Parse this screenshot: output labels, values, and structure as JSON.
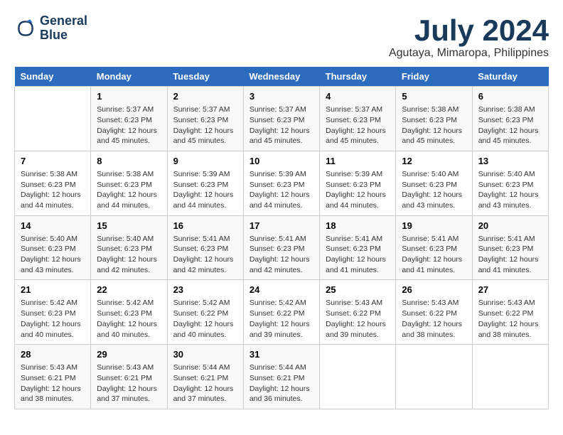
{
  "logo": {
    "line1": "General",
    "line2": "Blue"
  },
  "title": "July 2024",
  "subtitle": "Agutaya, Mimaropa, Philippines",
  "weekdays": [
    "Sunday",
    "Monday",
    "Tuesday",
    "Wednesday",
    "Thursday",
    "Friday",
    "Saturday"
  ],
  "weeks": [
    [
      {
        "day": "",
        "sunrise": "",
        "sunset": "",
        "daylight": ""
      },
      {
        "day": "1",
        "sunrise": "Sunrise: 5:37 AM",
        "sunset": "Sunset: 6:23 PM",
        "daylight": "Daylight: 12 hours and 45 minutes."
      },
      {
        "day": "2",
        "sunrise": "Sunrise: 5:37 AM",
        "sunset": "Sunset: 6:23 PM",
        "daylight": "Daylight: 12 hours and 45 minutes."
      },
      {
        "day": "3",
        "sunrise": "Sunrise: 5:37 AM",
        "sunset": "Sunset: 6:23 PM",
        "daylight": "Daylight: 12 hours and 45 minutes."
      },
      {
        "day": "4",
        "sunrise": "Sunrise: 5:37 AM",
        "sunset": "Sunset: 6:23 PM",
        "daylight": "Daylight: 12 hours and 45 minutes."
      },
      {
        "day": "5",
        "sunrise": "Sunrise: 5:38 AM",
        "sunset": "Sunset: 6:23 PM",
        "daylight": "Daylight: 12 hours and 45 minutes."
      },
      {
        "day": "6",
        "sunrise": "Sunrise: 5:38 AM",
        "sunset": "Sunset: 6:23 PM",
        "daylight": "Daylight: 12 hours and 45 minutes."
      }
    ],
    [
      {
        "day": "7",
        "sunrise": "Sunrise: 5:38 AM",
        "sunset": "Sunset: 6:23 PM",
        "daylight": "Daylight: 12 hours and 44 minutes."
      },
      {
        "day": "8",
        "sunrise": "Sunrise: 5:38 AM",
        "sunset": "Sunset: 6:23 PM",
        "daylight": "Daylight: 12 hours and 44 minutes."
      },
      {
        "day": "9",
        "sunrise": "Sunrise: 5:39 AM",
        "sunset": "Sunset: 6:23 PM",
        "daylight": "Daylight: 12 hours and 44 minutes."
      },
      {
        "day": "10",
        "sunrise": "Sunrise: 5:39 AM",
        "sunset": "Sunset: 6:23 PM",
        "daylight": "Daylight: 12 hours and 44 minutes."
      },
      {
        "day": "11",
        "sunrise": "Sunrise: 5:39 AM",
        "sunset": "Sunset: 6:23 PM",
        "daylight": "Daylight: 12 hours and 44 minutes."
      },
      {
        "day": "12",
        "sunrise": "Sunrise: 5:40 AM",
        "sunset": "Sunset: 6:23 PM",
        "daylight": "Daylight: 12 hours and 43 minutes."
      },
      {
        "day": "13",
        "sunrise": "Sunrise: 5:40 AM",
        "sunset": "Sunset: 6:23 PM",
        "daylight": "Daylight: 12 hours and 43 minutes."
      }
    ],
    [
      {
        "day": "14",
        "sunrise": "Sunrise: 5:40 AM",
        "sunset": "Sunset: 6:23 PM",
        "daylight": "Daylight: 12 hours and 43 minutes."
      },
      {
        "day": "15",
        "sunrise": "Sunrise: 5:40 AM",
        "sunset": "Sunset: 6:23 PM",
        "daylight": "Daylight: 12 hours and 42 minutes."
      },
      {
        "day": "16",
        "sunrise": "Sunrise: 5:41 AM",
        "sunset": "Sunset: 6:23 PM",
        "daylight": "Daylight: 12 hours and 42 minutes."
      },
      {
        "day": "17",
        "sunrise": "Sunrise: 5:41 AM",
        "sunset": "Sunset: 6:23 PM",
        "daylight": "Daylight: 12 hours and 42 minutes."
      },
      {
        "day": "18",
        "sunrise": "Sunrise: 5:41 AM",
        "sunset": "Sunset: 6:23 PM",
        "daylight": "Daylight: 12 hours and 41 minutes."
      },
      {
        "day": "19",
        "sunrise": "Sunrise: 5:41 AM",
        "sunset": "Sunset: 6:23 PM",
        "daylight": "Daylight: 12 hours and 41 minutes."
      },
      {
        "day": "20",
        "sunrise": "Sunrise: 5:41 AM",
        "sunset": "Sunset: 6:23 PM",
        "daylight": "Daylight: 12 hours and 41 minutes."
      }
    ],
    [
      {
        "day": "21",
        "sunrise": "Sunrise: 5:42 AM",
        "sunset": "Sunset: 6:23 PM",
        "daylight": "Daylight: 12 hours and 40 minutes."
      },
      {
        "day": "22",
        "sunrise": "Sunrise: 5:42 AM",
        "sunset": "Sunset: 6:23 PM",
        "daylight": "Daylight: 12 hours and 40 minutes."
      },
      {
        "day": "23",
        "sunrise": "Sunrise: 5:42 AM",
        "sunset": "Sunset: 6:22 PM",
        "daylight": "Daylight: 12 hours and 40 minutes."
      },
      {
        "day": "24",
        "sunrise": "Sunrise: 5:42 AM",
        "sunset": "Sunset: 6:22 PM",
        "daylight": "Daylight: 12 hours and 39 minutes."
      },
      {
        "day": "25",
        "sunrise": "Sunrise: 5:43 AM",
        "sunset": "Sunset: 6:22 PM",
        "daylight": "Daylight: 12 hours and 39 minutes."
      },
      {
        "day": "26",
        "sunrise": "Sunrise: 5:43 AM",
        "sunset": "Sunset: 6:22 PM",
        "daylight": "Daylight: 12 hours and 38 minutes."
      },
      {
        "day": "27",
        "sunrise": "Sunrise: 5:43 AM",
        "sunset": "Sunset: 6:22 PM",
        "daylight": "Daylight: 12 hours and 38 minutes."
      }
    ],
    [
      {
        "day": "28",
        "sunrise": "Sunrise: 5:43 AM",
        "sunset": "Sunset: 6:21 PM",
        "daylight": "Daylight: 12 hours and 38 minutes."
      },
      {
        "day": "29",
        "sunrise": "Sunrise: 5:43 AM",
        "sunset": "Sunset: 6:21 PM",
        "daylight": "Daylight: 12 hours and 37 minutes."
      },
      {
        "day": "30",
        "sunrise": "Sunrise: 5:44 AM",
        "sunset": "Sunset: 6:21 PM",
        "daylight": "Daylight: 12 hours and 37 minutes."
      },
      {
        "day": "31",
        "sunrise": "Sunrise: 5:44 AM",
        "sunset": "Sunset: 6:21 PM",
        "daylight": "Daylight: 12 hours and 36 minutes."
      },
      {
        "day": "",
        "sunrise": "",
        "sunset": "",
        "daylight": ""
      },
      {
        "day": "",
        "sunrise": "",
        "sunset": "",
        "daylight": ""
      },
      {
        "day": "",
        "sunrise": "",
        "sunset": "",
        "daylight": ""
      }
    ]
  ]
}
